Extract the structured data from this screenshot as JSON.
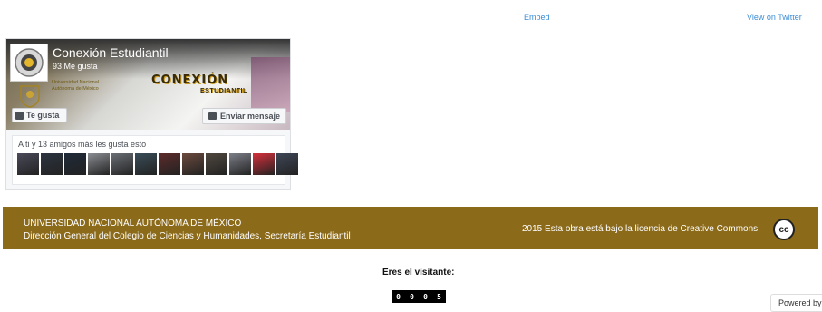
{
  "top_links": {
    "embed": "Embed",
    "view_twitter": "View on Twitter"
  },
  "fb_widget": {
    "page_name": "Conexión Estudiantil",
    "likes_count": "93 Me gusta",
    "like_button": "Te gusta",
    "message_button": "Enviar mensaje",
    "friends_text": "A ti y 13 amigos más les gusta esto",
    "friend_avatar_colors": [
      "#4a4a5a",
      "#2c3440",
      "#1f2a38",
      "#8a8d92",
      "#6a6f75",
      "#3a4d58",
      "#5e2b2b",
      "#6b4a3e",
      "#50483f",
      "#7d7f88",
      "#d6303c",
      "#3e4656"
    ]
  },
  "cover": {
    "logo_main": "CONEXIÓN",
    "logo_sub": "ESTUDIANTIL",
    "unam_text_1": "Universidad Nacional",
    "unam_text_2": "Autónoma de México"
  },
  "footer": {
    "line1": "UNIVERSIDAD NACIONAL AUTÓNOMA DE MÉXICO",
    "line2": "Dirección General del Colegio de Ciencias y Humanidades, Secretaría Estudiantil",
    "license": "2015 Esta obra está bajo la licencia de Creative Commons",
    "cc_badge": "cc",
    "bg_color": "#8b6a1a"
  },
  "visitor": {
    "label": "Eres el visitante:",
    "digits": [
      "0",
      "0",
      "0",
      "5"
    ]
  },
  "powered_by": "Powered by"
}
